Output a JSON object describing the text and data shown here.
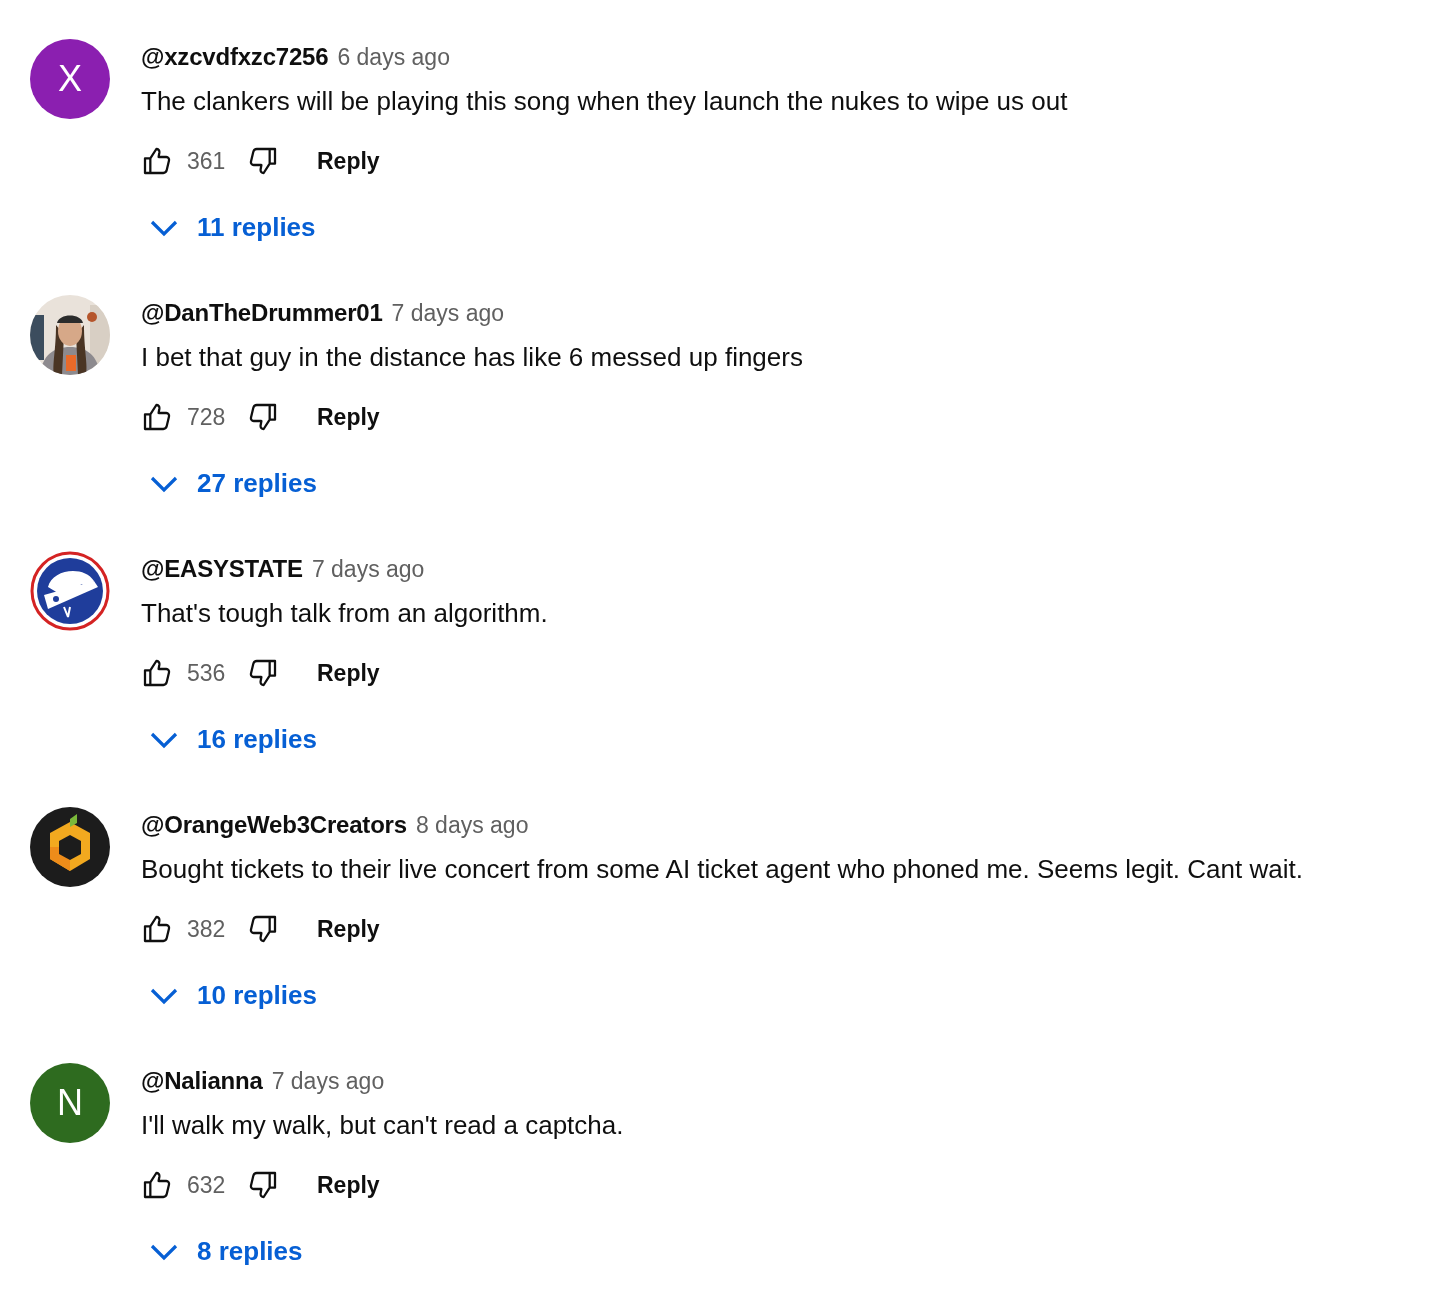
{
  "comments": [
    {
      "avatar": {
        "kind": "letter",
        "letter": "X",
        "color": "#8b1fb0"
      },
      "author": "@xzcvdfxzc7256",
      "time": "6 days ago",
      "text": "The clankers will be playing this song when they launch the nukes to wipe us out",
      "likes": "361",
      "reply_label": "Reply",
      "replies": "11 replies"
    },
    {
      "author": "@DanTheDrummer01",
      "time": "7 days ago",
      "text": "I bet that guy in the distance has like 6 messed up fingers",
      "likes": "728",
      "reply_label": "Reply",
      "replies": "27 replies"
    },
    {
      "avatar": {
        "kind": "parachute"
      },
      "author": "@EASYSTATE",
      "time": "7 days ago",
      "text": "That's tough talk from an algorithm.",
      "likes": "536",
      "reply_label": "Reply",
      "replies": "16 replies"
    },
    {
      "avatar": {
        "kind": "cube"
      },
      "author": "@OrangeWeb3Creators",
      "time": "8 days ago",
      "text": "Bought tickets to their live concert from some AI ticket agent who phoned me. Seems legit. Cant wait.",
      "likes": "382",
      "reply_label": "Reply",
      "replies": "10 replies"
    },
    {
      "avatar": {
        "kind": "letter",
        "letter": "N",
        "color": "#2e6b1f"
      },
      "author": "@Nalianna",
      "time": "7 days ago",
      "text": "I'll walk my walk, but can't read a captcha.",
      "likes": "632",
      "reply_label": "Reply",
      "replies": "8 replies"
    }
  ]
}
